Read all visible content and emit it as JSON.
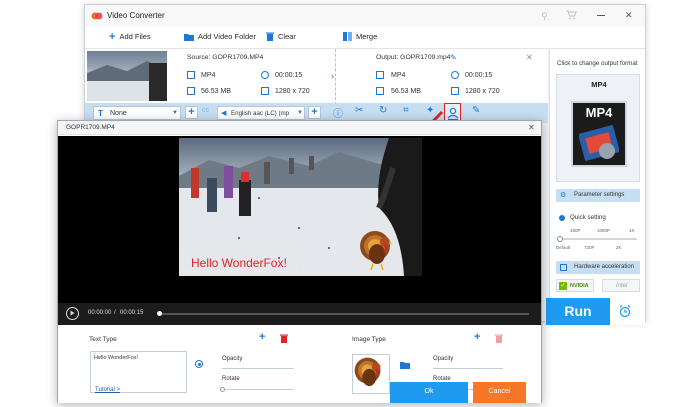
{
  "app": {
    "title": "Video Converter",
    "toolbar": {
      "add_files": "Add Files",
      "add_video_folder": "Add Video Folder",
      "clear": "Clear",
      "merge": "Merge"
    }
  },
  "file": {
    "source_label": "Source: GOPR1709.MP4",
    "output_label": "Output: GOPR1709.mp4",
    "src_format": "MP4",
    "src_duration": "00:00:15",
    "src_size": "56.53 MB",
    "src_resolution": "1280 x 720",
    "out_format": "MP4",
    "out_duration": "00:00:15",
    "out_size": "56.53 MB",
    "out_resolution": "1280 x 720"
  },
  "editbar": {
    "subtitle": "None",
    "audio": "English aac (LC) (mp"
  },
  "output_panel": {
    "hint": "Click to change output format",
    "format": "MP4",
    "format_tile": "MP4",
    "parameter_settings": "Parameter settings",
    "quick_setting": "Quick setting",
    "ticks_top": [
      "480P",
      "1080P",
      "4K"
    ],
    "ticks_bottom": [
      "Default",
      "720P",
      "2K"
    ],
    "hardware_acceleration": "Hardware acceleration",
    "nvidia": "NVIDIA",
    "intel": "Intel",
    "run": "Run"
  },
  "dialog": {
    "title": "GOPR1709.MP4",
    "watermark_text": "Hello WonderFox!",
    "time_current": "00:00:00",
    "time_sep": "/",
    "time_total": "00:00:15",
    "text_type_label": "Text Type",
    "text_value": "Hello WonderFox!",
    "opacity_label": "Opacity",
    "rotate_label": "Rotate",
    "image_type_label": "Image Type",
    "image_opacity_label": "Opacity",
    "image_rotate_label": "Rotate",
    "tutorial": "Tutorial >",
    "ok": "Ok",
    "cancel": "Cancel"
  },
  "colors": {
    "accent_blue": "#1e9bf0",
    "cancel_orange": "#f6762a",
    "highlight_red": "#e02424",
    "editbar_blue": "#c6def2"
  }
}
